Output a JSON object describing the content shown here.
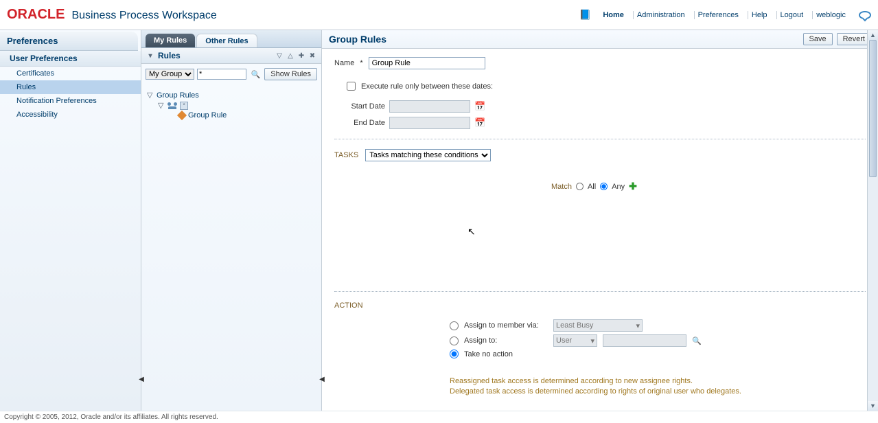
{
  "header": {
    "logo_text": "ORACLE",
    "app_title": "Business Process Workspace",
    "links": {
      "home": "Home",
      "admin": "Administration",
      "prefs": "Preferences",
      "help": "Help",
      "logout": "Logout",
      "user": "weblogic"
    }
  },
  "left": {
    "title": "Preferences",
    "subtitle": "User Preferences",
    "items": [
      "Certificates",
      "Rules",
      "Notification Preferences",
      "Accessibility"
    ],
    "selected_index": 1
  },
  "tabs": {
    "my": "My Rules",
    "other": "Other Rules"
  },
  "rules_panel": {
    "title": "Rules",
    "group_select": "My Group",
    "filter_value": "*",
    "show_rules_btn": "Show Rules",
    "tree": {
      "root": "Group Rules",
      "leaf": "Group Rule"
    }
  },
  "form": {
    "title": "Group Rules",
    "save": "Save",
    "revert": "Revert",
    "name_label": "Name",
    "name_value": "Group Rule",
    "execute_checkbox": "Execute rule only between these dates:",
    "start_date": "Start Date",
    "end_date": "End Date",
    "tasks_label": "TASKS",
    "tasks_select": "Tasks matching these conditions",
    "match_label": "Match",
    "match_all": "All",
    "match_any": "Any",
    "action_label": "ACTION",
    "action_assign_member": "Assign to member via:",
    "action_assign_member_value": "Least Busy",
    "action_assign_to": "Assign to:",
    "action_assign_to_type": "User",
    "action_take_none": "Take no action",
    "info1": "Reassigned task access is determined according to new assignee rights.",
    "info2": "Delegated task access is determined according to rights of original user who delegates."
  },
  "footer": "Copyright © 2005, 2012, Oracle and/or its affiliates. All rights reserved."
}
